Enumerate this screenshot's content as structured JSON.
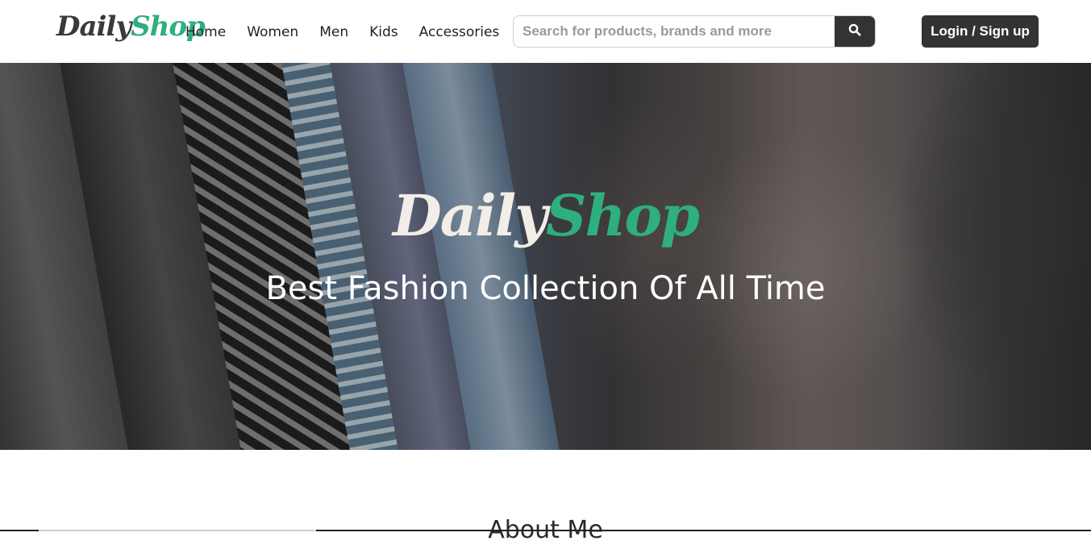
{
  "brand": {
    "part1": "Daily",
    "part2": "Shop"
  },
  "nav": [
    "Home",
    "Women",
    "Men",
    "Kids",
    "Accessories"
  ],
  "search": {
    "placeholder": "Search for products, brands and more",
    "button_icon": "search-icon"
  },
  "login_label": "Login / Sign up",
  "hero": {
    "logo_part1": "Daily",
    "logo_part2": "Shop",
    "tagline": "Best Fashion Collection Of All Time"
  },
  "section_title": "About Me",
  "colors": {
    "accent": "#2eaf7d",
    "dark": "#333333",
    "text": "#222222"
  }
}
